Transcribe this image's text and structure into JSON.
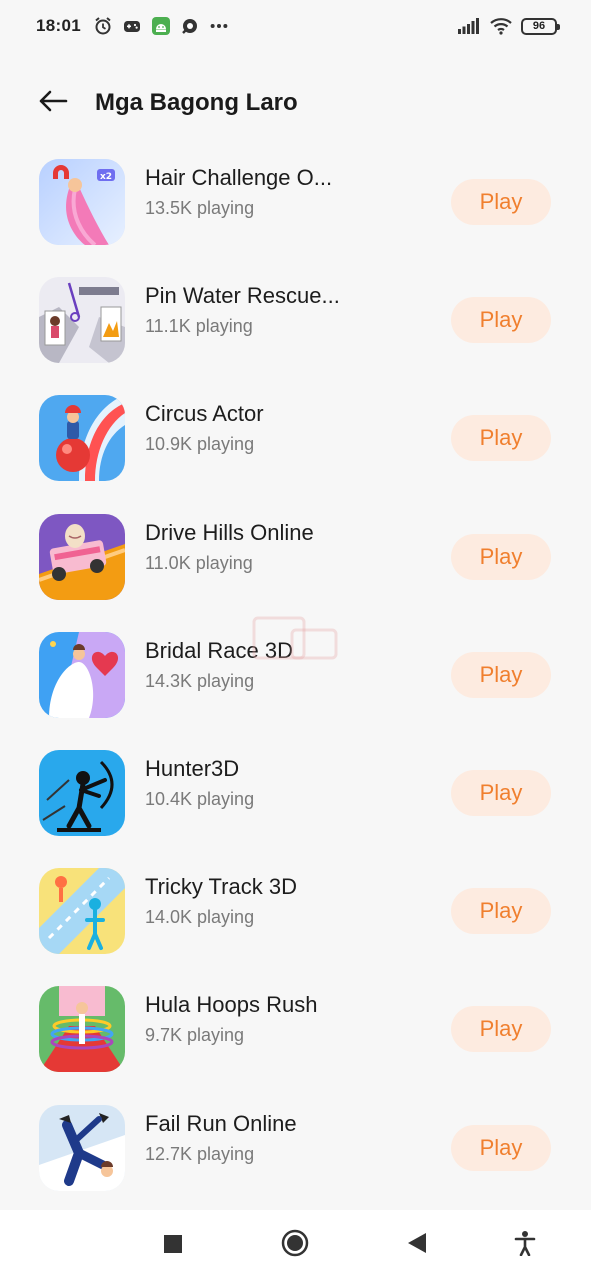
{
  "status_bar": {
    "time": "18:01",
    "icons": [
      "alarm-icon",
      "gamepad-icon",
      "android-app-icon",
      "chat-bubble-icon",
      "more-dots-icon"
    ],
    "battery": "96"
  },
  "header": {
    "title": "Mga Bagong Laro"
  },
  "play_label": "Play",
  "games": [
    {
      "title": "Hair Challenge O...",
      "players": "13.5K playing"
    },
    {
      "title": "Pin Water Rescue...",
      "players": "11.1K playing"
    },
    {
      "title": "Circus Actor",
      "players": "10.9K playing"
    },
    {
      "title": "Drive Hills Online",
      "players": "11.0K playing"
    },
    {
      "title": "Bridal Race 3D",
      "players": "14.3K playing"
    },
    {
      "title": "Hunter3D",
      "players": "10.4K playing"
    },
    {
      "title": "Tricky Track 3D",
      "players": "14.0K playing"
    },
    {
      "title": "Hula Hoops Rush",
      "players": "9.7K playing"
    },
    {
      "title": "Fail Run Online",
      "players": "12.7K playing"
    }
  ],
  "colors": {
    "accent": "#f07f2e",
    "play_bg": "#fdebe0",
    "background": "#f7f7f7"
  },
  "nav_bar": {
    "icons": [
      "recents-square-icon",
      "home-circle-icon",
      "back-triangle-icon",
      "accessibility-icon"
    ]
  }
}
